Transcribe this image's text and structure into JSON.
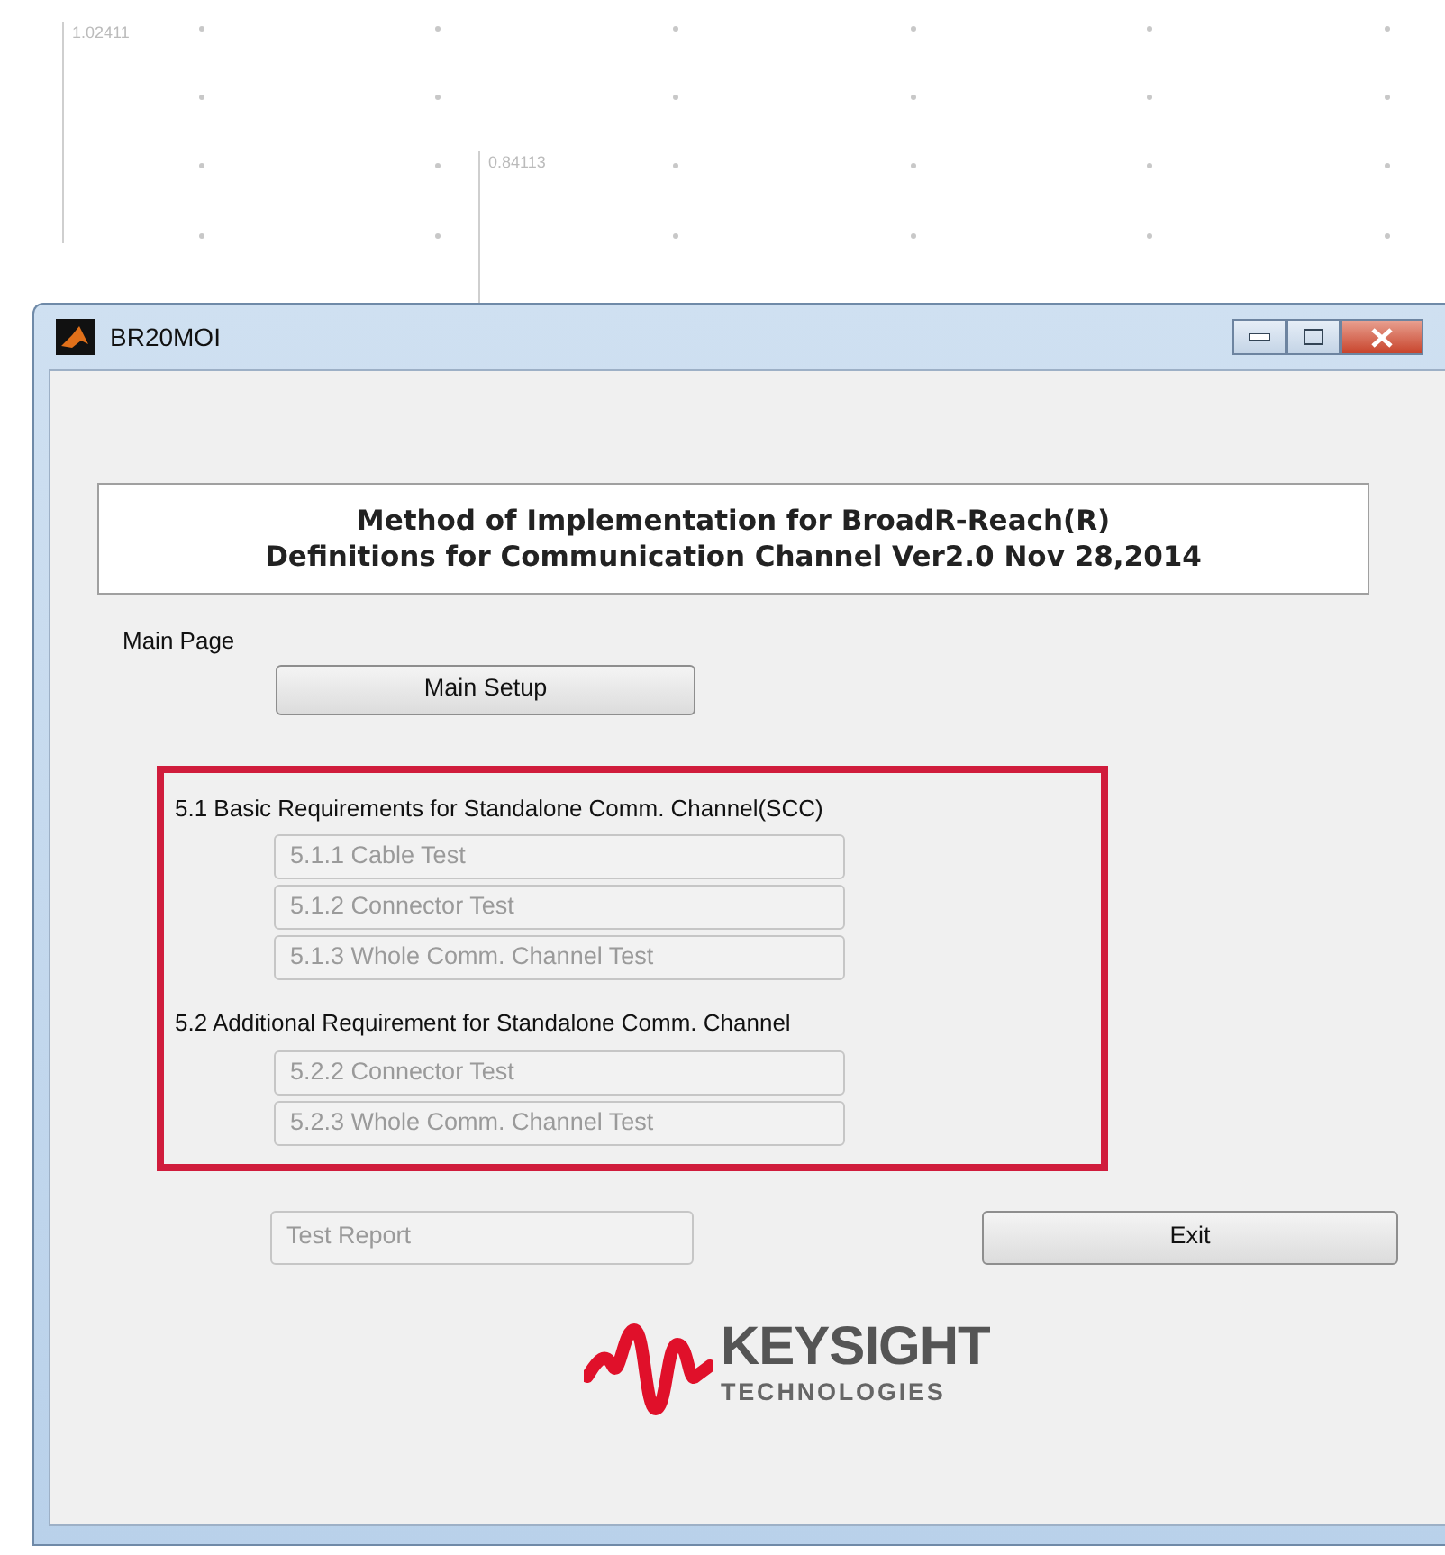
{
  "background_plot": {
    "readouts": [
      "1.02411",
      "0.84113"
    ]
  },
  "window": {
    "title": "BR20MOI"
  },
  "header": {
    "lines": [
      "Method of Implementation for BroadR-Reach(R)",
      "Definitions for Communication Channel Ver2.0 Nov 28,2014"
    ]
  },
  "main_page": {
    "label": "Main Page",
    "buttons": [
      {
        "label": "Main Setup",
        "disabled": false
      }
    ]
  },
  "sections": [
    {
      "title": "5.1 Basic Requirements for Standalone Comm. Channel(SCC)",
      "buttons": [
        {
          "label": "5.1.1 Cable Test",
          "disabled": true
        },
        {
          "label": "5.1.2 Connector Test",
          "disabled": true
        },
        {
          "label": "5.1.3 Whole Comm. Channel Test",
          "disabled": true
        }
      ]
    },
    {
      "title": "5.2 Additional Requirement for Standalone Comm. Channel",
      "buttons": [
        {
          "label": "5.2.2 Connector Test",
          "disabled": true
        },
        {
          "label": "5.2.3 Whole Comm. Channel Test",
          "disabled": true
        }
      ]
    }
  ],
  "bottom_buttons": [
    {
      "label": "Test Report",
      "disabled": true
    },
    {
      "label": "Exit",
      "disabled": false
    }
  ],
  "logo": {
    "name": "KEYSIGHT",
    "tagline": "TECHNOLOGIES"
  }
}
